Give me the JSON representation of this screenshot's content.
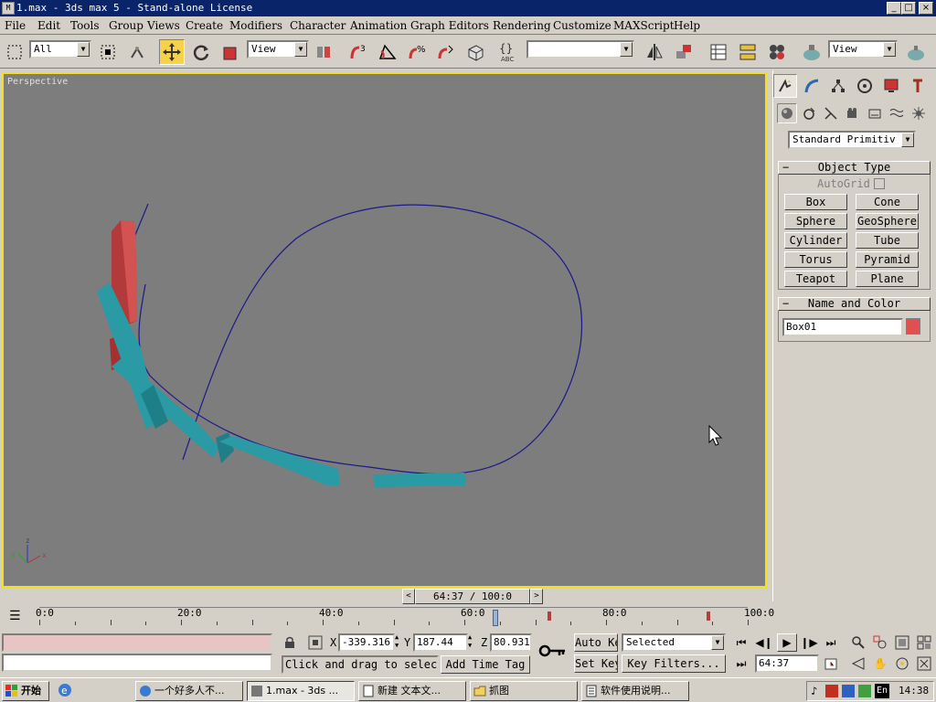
{
  "window": {
    "title": "1.max - 3ds max 5 - Stand-alone License",
    "app_icon": "3ds-max-icon",
    "buttons": {
      "minimize": "_",
      "maximize": "□",
      "close": "×"
    }
  },
  "menu": [
    "File",
    "Edit",
    "Tools",
    "Group",
    "Views",
    "Create",
    "Modifiers",
    "Character",
    "Animation",
    "Graph Editors",
    "Rendering",
    "Customize",
    "MAXScript",
    "Help"
  ],
  "toolbar": {
    "selection_filter": "All",
    "ref_coord": "View",
    "named_selection": "",
    "render_view": "View",
    "snap_labels": [
      "3",
      "%"
    ],
    "abc_label": "ABC"
  },
  "viewport": {
    "label": "Perspective",
    "axis": {
      "x": "x",
      "y": "y",
      "z": "z"
    }
  },
  "command_panel": {
    "main_tabs": [
      "create",
      "modify",
      "hierarchy",
      "motion",
      "display",
      "utilities"
    ],
    "sub_tabs": [
      "geometry",
      "shapes",
      "lights",
      "cameras",
      "helpers",
      "space-warps",
      "systems"
    ],
    "category": "Standard Primitiv",
    "object_type": {
      "header": "Object Type",
      "autogrid": "AutoGrid",
      "buttons": [
        "Box",
        "Cone",
        "Sphere",
        "GeoSphere",
        "Cylinder",
        "Tube",
        "Torus",
        "Pyramid",
        "Teapot",
        "Plane"
      ]
    },
    "name_and_color": {
      "header": "Name and Color",
      "name": "Box01",
      "color": "#e05050"
    }
  },
  "time_slider": {
    "label": "64:37 / 100:0",
    "prev": "<",
    "next": ">"
  },
  "trackbar": {
    "ticks": [
      "0:0",
      "20:0",
      "40:0",
      "60:0",
      "80:0",
      "100:0"
    ],
    "current_frame_fraction": 0.6437
  },
  "status": {
    "prompt": "Click and drag to select",
    "add_time_tag": "Add Time Tag",
    "x_label": "X:",
    "x_value": "-339.316",
    "y_label": "Y:",
    "y_value": "187.44",
    "z_label": "Z:",
    "z_value": "80.931",
    "auto_key": "Auto Key",
    "set_key": "Set Key",
    "key_mode": "Selected",
    "key_filters": "Key Filters...",
    "frame": "64:37"
  },
  "taskbar": {
    "start": "开始",
    "tasks": [
      {
        "label": "一个好多人不...",
        "icon": "ie-icon"
      },
      {
        "label": "1.max - 3ds ...",
        "icon": "max-icon",
        "active": true
      },
      {
        "label": "新建 文本文...",
        "icon": "notepad-icon"
      },
      {
        "label": "抓图",
        "icon": "folder-icon"
      },
      {
        "label": "软件使用说明...",
        "icon": "doc-icon"
      }
    ],
    "clock": "14:38",
    "lang": "En"
  }
}
